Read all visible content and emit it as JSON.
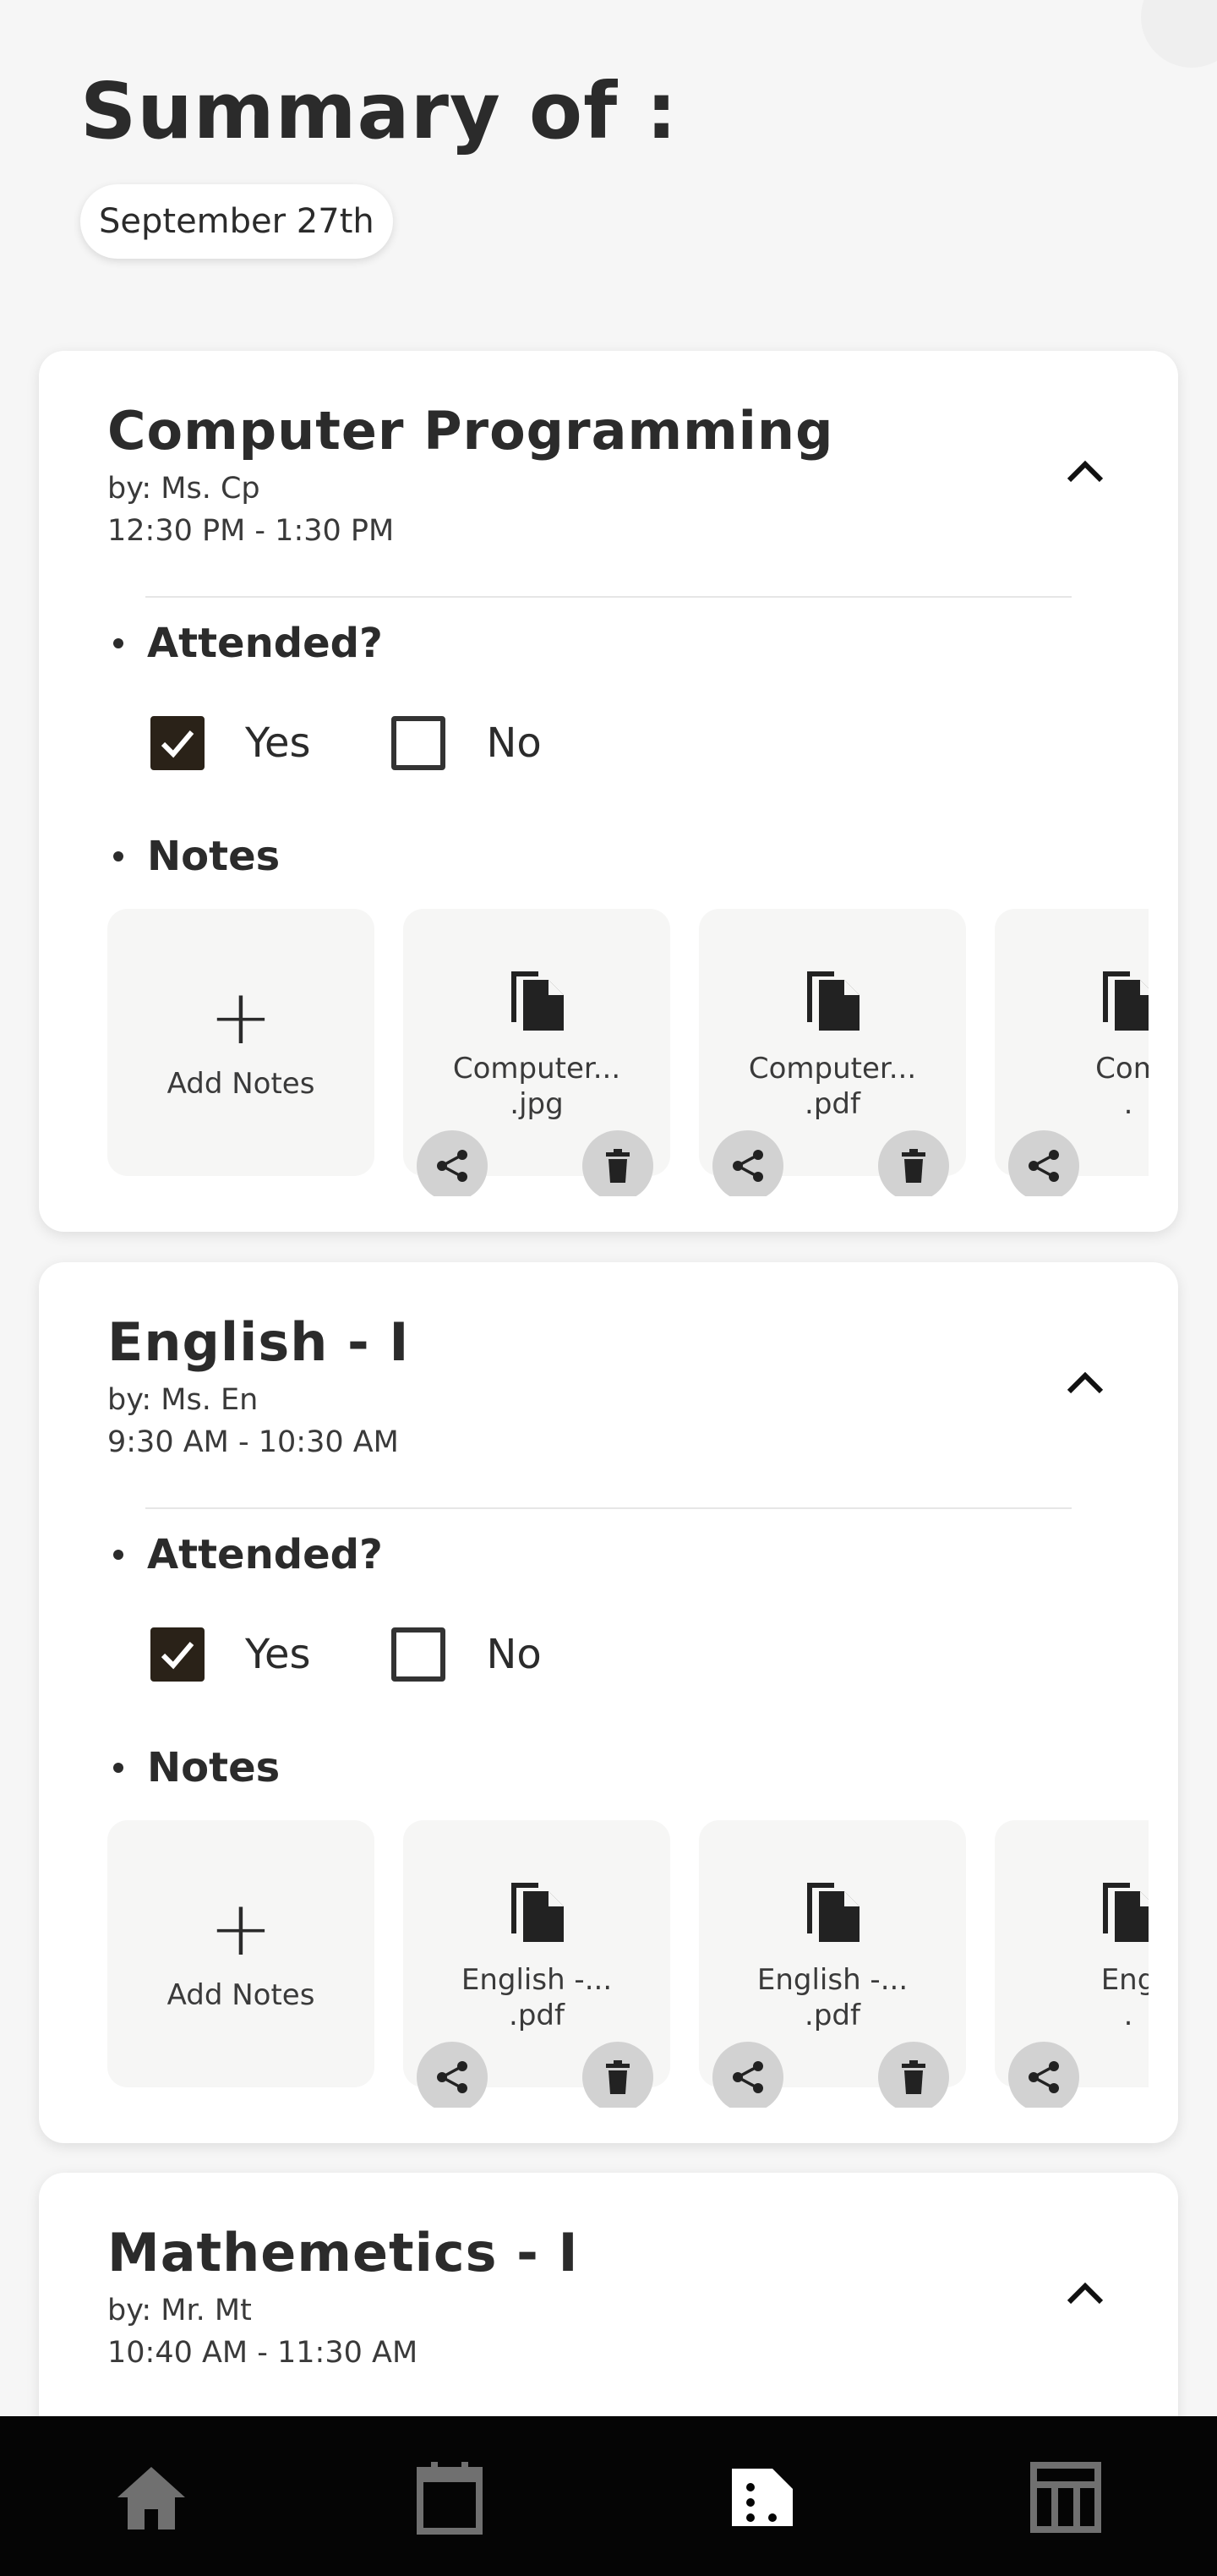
{
  "header": {
    "title": "Summary of :",
    "date": "September 27th"
  },
  "courses": [
    {
      "title": "Computer Programming",
      "by": "by: Ms. Cp",
      "time": "12:30 PM - 1:30 PM",
      "attended_label": "Attended?",
      "yes_label": "Yes",
      "no_label": "No",
      "attended": "Yes",
      "notes_label": "Notes",
      "add_notes_label": "Add Notes",
      "files": [
        {
          "name": "Computer...",
          "ext": ".jpg"
        },
        {
          "name": "Computer...",
          "ext": ".pdf"
        },
        {
          "name": "Com",
          "ext": "."
        }
      ]
    },
    {
      "title": "English - I",
      "by": "by: Ms. En",
      "time": "9:30 AM - 10:30 AM",
      "attended_label": "Attended?",
      "yes_label": "Yes",
      "no_label": "No",
      "attended": "Yes",
      "notes_label": "Notes",
      "add_notes_label": "Add Notes",
      "files": [
        {
          "name": "English -...",
          "ext": ".pdf"
        },
        {
          "name": "English -...",
          "ext": ".pdf"
        },
        {
          "name": "Eng",
          "ext": "."
        }
      ]
    },
    {
      "title": "Mathemetics - I",
      "by": "by: Mr. Mt",
      "time": "10:40 AM - 11:30 AM"
    }
  ],
  "nav": {
    "items": [
      {
        "icon": "home-icon",
        "active": false
      },
      {
        "icon": "calendar-icon",
        "active": false
      },
      {
        "icon": "notes-icon",
        "active": true
      },
      {
        "icon": "timetable-icon",
        "active": false
      }
    ],
    "colors": {
      "active": "#ffffff",
      "inactive": "#707070",
      "background": "#050505"
    }
  }
}
